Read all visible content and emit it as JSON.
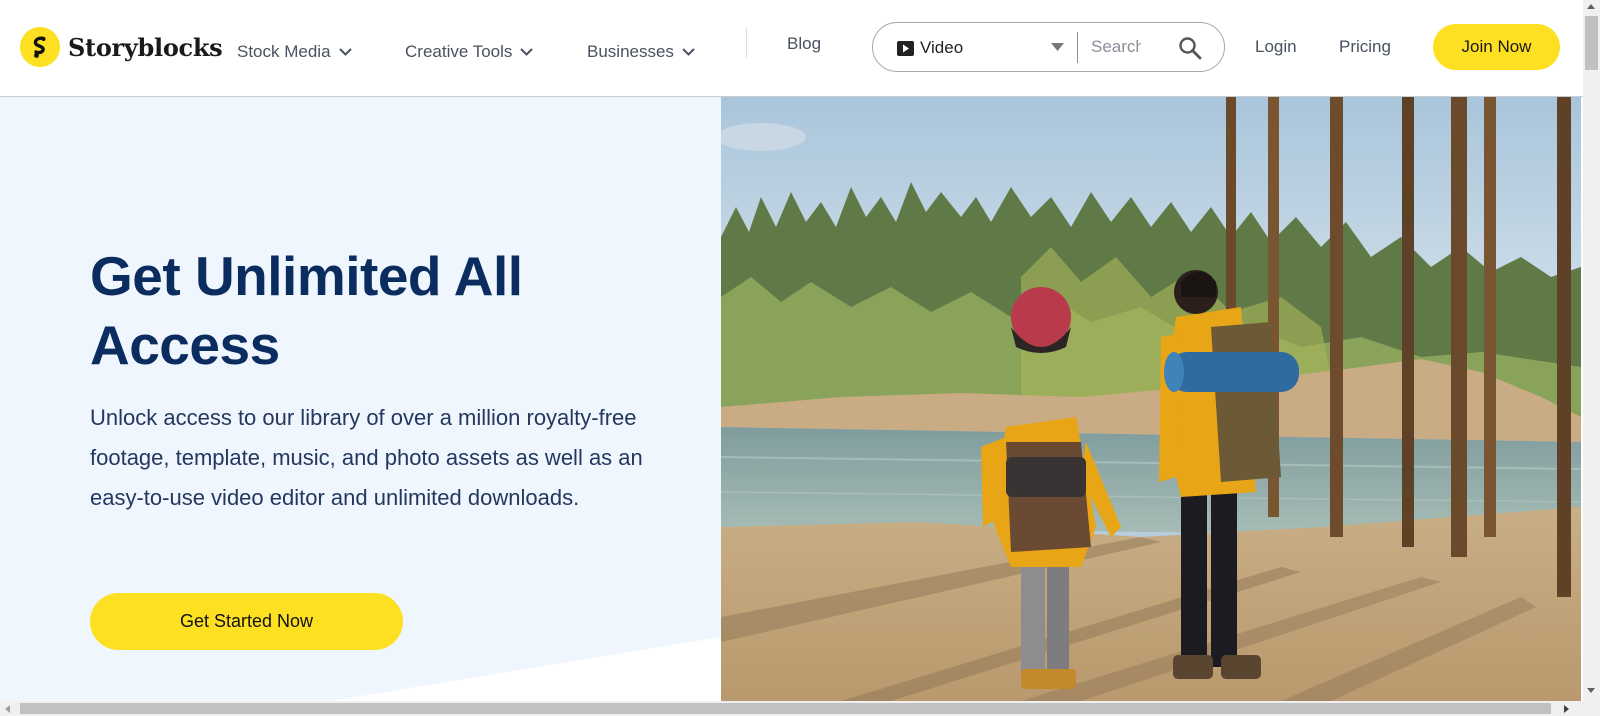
{
  "brand": {
    "name": "Storyblocks",
    "logo_letter": "S",
    "accent_color": "#fde022",
    "heading_color": "#0b2c5f"
  },
  "nav": {
    "items": [
      {
        "label": "Stock Media",
        "icon": "chevron-down-icon"
      },
      {
        "label": "Creative Tools",
        "icon": "chevron-down-icon"
      },
      {
        "label": "Businesses",
        "icon": "chevron-down-icon"
      }
    ],
    "blog": "Blog",
    "login": "Login",
    "pricing": "Pricing",
    "join": "Join Now"
  },
  "search": {
    "type_icon": "video-play-icon",
    "type_value": "Video",
    "placeholder": "Search",
    "submit_icon": "search-icon"
  },
  "hero": {
    "title": "Get Unlimited All Access",
    "body": "Unlock access to our library of over a million royalty-free footage, template, music, and photo assets as well as an easy-to-use video editor and unlimited downloads.",
    "cta": "Get Started Now",
    "image_subject": "two-hikers-with-backpacks-by-lake"
  }
}
